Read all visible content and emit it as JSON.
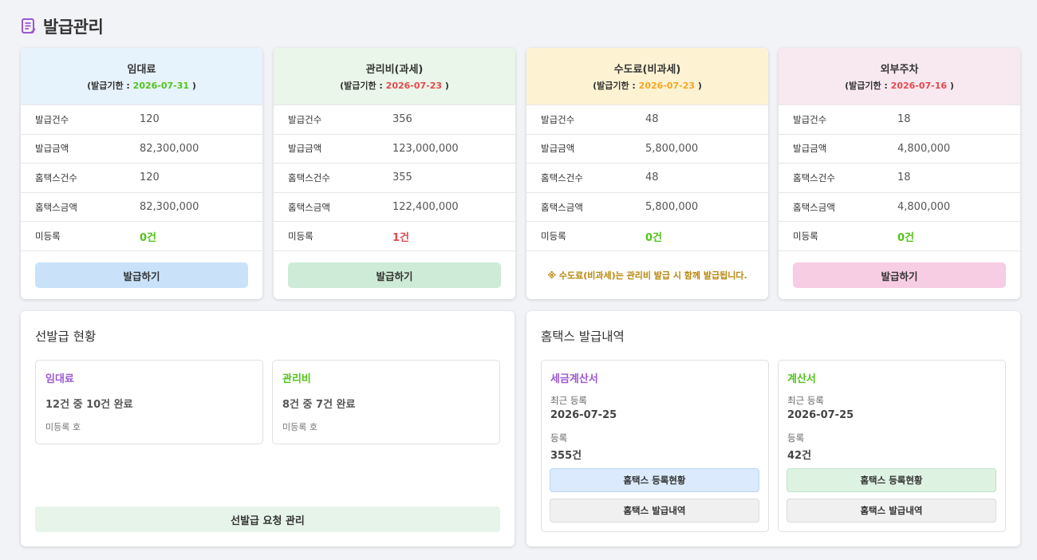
{
  "page": {
    "title": "발급관리",
    "icon": "document-icon"
  },
  "colors": {
    "green": "#52c41a",
    "red": "#e5484d",
    "orange": "#f5a623",
    "purple": "#9b59d0",
    "gold": "#b8860b"
  },
  "cards": [
    {
      "name": "임대료",
      "deadline_prefix": "(발급기한 : ",
      "deadline": "2026-07-31",
      "deadline_suffix": " )",
      "rows": [
        {
          "label": "발급건수",
          "value": "120"
        },
        {
          "label": "발급금액",
          "value": "82,300,000"
        },
        {
          "label": "홈택스건수",
          "value": "120"
        },
        {
          "label": "홈택스금액",
          "value": "82,300,000"
        },
        {
          "label": "미등록",
          "value": "0건"
        }
      ],
      "button": "발급하기"
    },
    {
      "name": "관리비(과세)",
      "deadline_prefix": "(발급기한 : ",
      "deadline": "2026-07-23",
      "deadline_suffix": " )",
      "rows": [
        {
          "label": "발급건수",
          "value": "356"
        },
        {
          "label": "발급금액",
          "value": "123,000,000"
        },
        {
          "label": "홈택스건수",
          "value": "355"
        },
        {
          "label": "홈택스금액",
          "value": "122,400,000"
        },
        {
          "label": "미등록",
          "value": "1건"
        }
      ],
      "button": "발급하기"
    },
    {
      "name": "수도료(비과세)",
      "deadline_prefix": "(발급기한 : ",
      "deadline": "2026-07-23",
      "deadline_suffix": " )",
      "rows": [
        {
          "label": "발급건수",
          "value": "48"
        },
        {
          "label": "발급금액",
          "value": "5,800,000"
        },
        {
          "label": "홈택스건수",
          "value": "48"
        },
        {
          "label": "홈택스금액",
          "value": "5,800,000"
        },
        {
          "label": "미등록",
          "value": "0건"
        }
      ],
      "notice": "※ 수도료(비과세)는 관리비 발급 시 함께 발급됩니다."
    },
    {
      "name": "외부주차",
      "deadline_prefix": "(발급기한 : ",
      "deadline": "2026-07-16",
      "deadline_suffix": " )",
      "rows": [
        {
          "label": "발급건수",
          "value": "18"
        },
        {
          "label": "발급금액",
          "value": "4,800,000"
        },
        {
          "label": "홈택스건수",
          "value": "18"
        },
        {
          "label": "홈택스금액",
          "value": "4,800,000"
        },
        {
          "label": "미등록",
          "value": "0건"
        }
      ],
      "button": "발급하기"
    }
  ],
  "preissue": {
    "title": "선발급 현황",
    "items": [
      {
        "title": "임대료",
        "progress": "12건 중 10건 완료",
        "note": "미등록 호"
      },
      {
        "title": "관리비",
        "progress": "8건 중 7건 완료",
        "note": "미등록 호"
      }
    ],
    "button": "선발급 요청 관리"
  },
  "hometax": {
    "title": "홈택스 발급내역",
    "boxes": [
      {
        "title": "세금계산서",
        "recent_label": "최근 등록",
        "recent_value": "2026-07-25",
        "count_label": "등록",
        "count_value": "355건",
        "btn_status": "홈택스 등록현황",
        "btn_history": "홈택스 발급내역"
      },
      {
        "title": "계산서",
        "recent_label": "최근 등록",
        "recent_value": "2026-07-25",
        "count_label": "등록",
        "count_value": "42건",
        "btn_status": "홈택스 등록현황",
        "btn_history": "홈택스 발급내역"
      }
    ]
  }
}
